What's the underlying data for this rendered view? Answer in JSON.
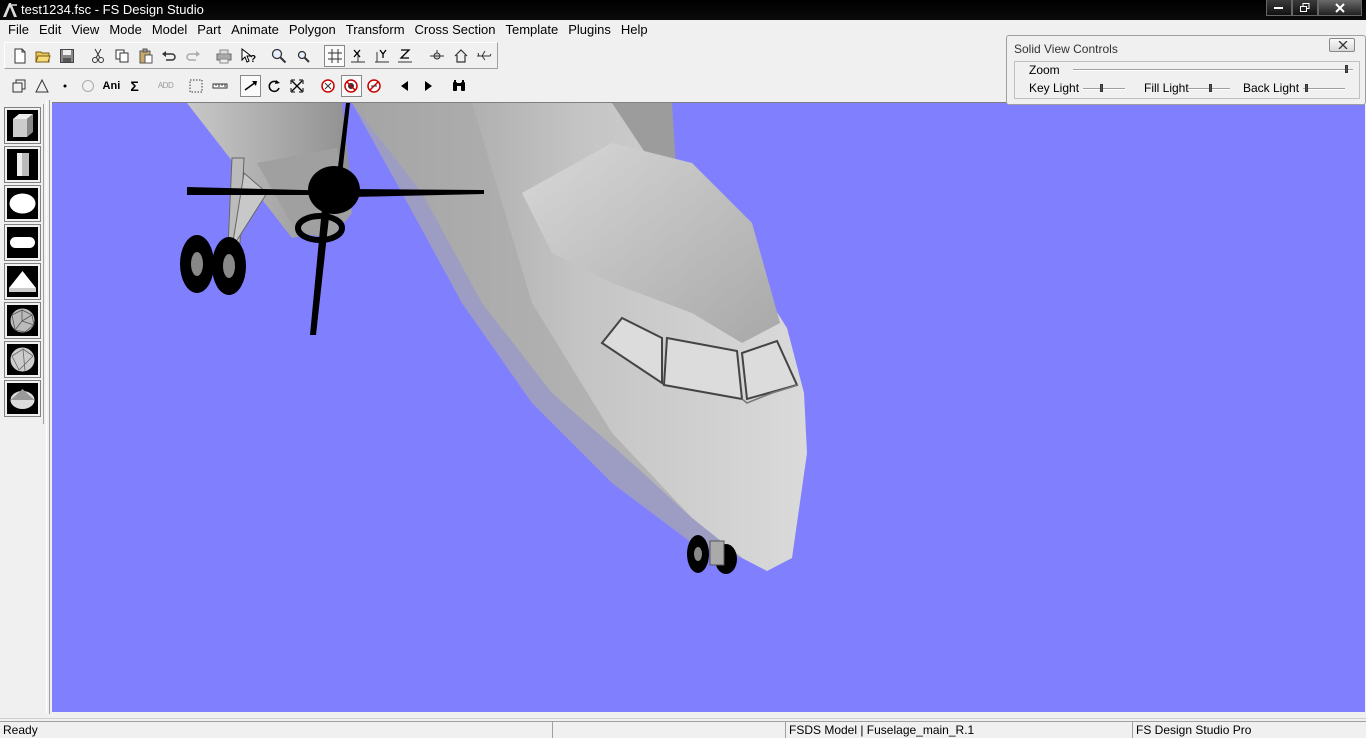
{
  "window": {
    "title": "test1234.fsc - FS Design Studio"
  },
  "menu": [
    "File",
    "Edit",
    "View",
    "Mode",
    "Model",
    "Part",
    "Animate",
    "Polygon",
    "Transform",
    "Cross Section",
    "Template",
    "Plugins",
    "Help"
  ],
  "toolbar_secondary": {
    "ani_label": "Ani",
    "sigma_label": "Σ",
    "add_label": "ADD"
  },
  "solid_view_controls": {
    "title": "Solid View Controls",
    "zoom_label": "Zoom",
    "key_light_label": "Key Light",
    "fill_light_label": "Fill Light",
    "back_light_label": "Back Light",
    "zoom_value": 0.98,
    "key_light_value": 0.45,
    "fill_light_value": 0.55,
    "back_light_value": 0.1
  },
  "viewport": {
    "background_color": "#8080ff"
  },
  "status": {
    "ready": "Ready",
    "model_info": "FSDS Model | Fuselage_main_R.1",
    "product": "FS Design Studio Pro"
  }
}
